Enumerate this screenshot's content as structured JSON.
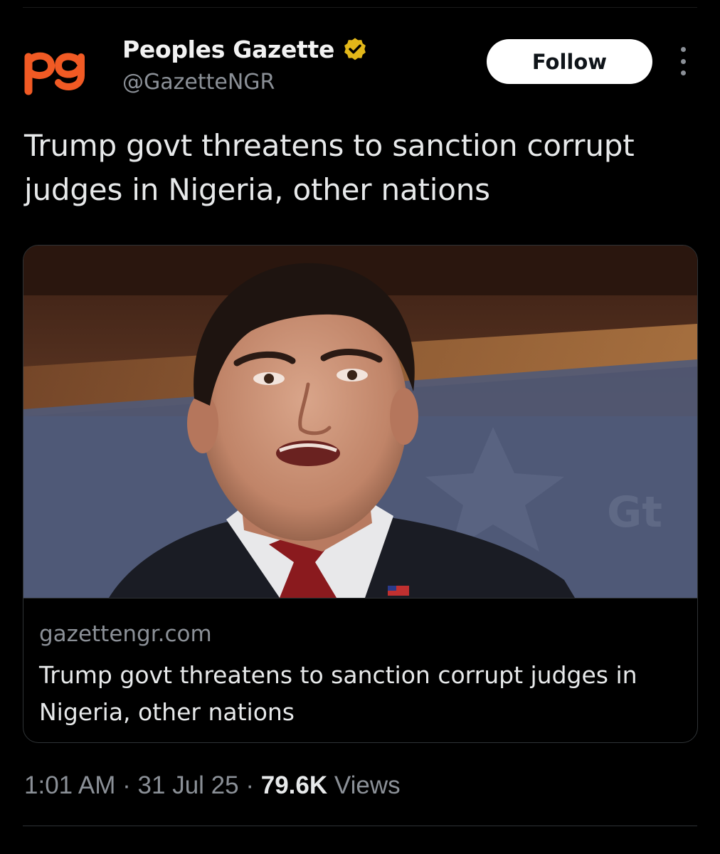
{
  "account": {
    "logo_text": "pg",
    "display_name": "Peoples Gazette",
    "verified": true,
    "verified_badge_color": "#e2b719",
    "logo_color": "#f15a24",
    "handle": "@GazetteNGR"
  },
  "actions": {
    "follow_label": "Follow",
    "more_icon": "more-vertical-icon"
  },
  "tweet": {
    "text": "Trump govt threatens to sanction corrupt judges in Nigeria, other nations"
  },
  "link_card": {
    "domain": "gazettengr.com",
    "title": "Trump govt threatens to sanction corrupt judges in Nigeria, other nations"
  },
  "meta": {
    "time": "1:01 AM",
    "separator": "·",
    "date": "31 Jul 25",
    "views_count": "79.6K",
    "views_label": "Views"
  },
  "colors": {
    "background": "#000000",
    "text_primary": "#e7e9ea",
    "text_secondary": "#8b9097",
    "border": "#2f3336",
    "follow_bg": "#ffffff"
  }
}
